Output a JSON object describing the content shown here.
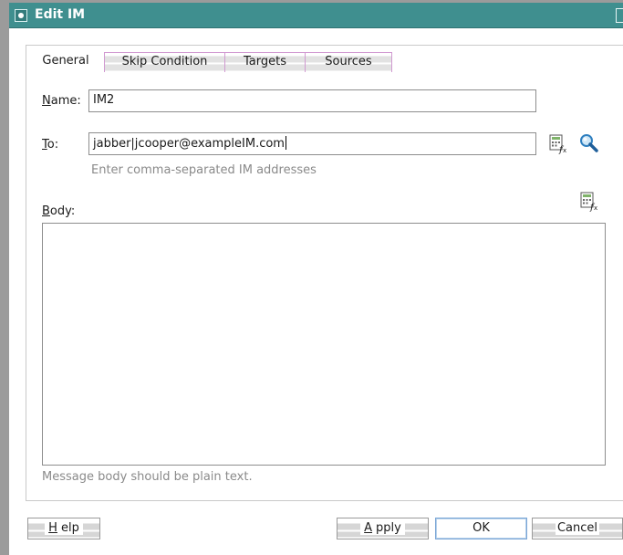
{
  "window": {
    "title": "Edit IM"
  },
  "tabs": [
    "General",
    "Skip Condition",
    "Targets",
    "Sources"
  ],
  "active_tab": "General",
  "form": {
    "name_label_mn": "N",
    "name_label_rest": "ame:",
    "name_value": "IM2",
    "to_label_mn": "T",
    "to_label_rest": "o:",
    "to_value": "jabber|jcooper@exampleIM.com",
    "to_hint": "Enter comma-separated IM addresses",
    "body_label_mn": "B",
    "body_label_rest": "ody:",
    "body_value": "",
    "body_hint": "Message body should be plain text."
  },
  "icons": {
    "expression_builder": "expression-builder-icon",
    "search": "search-icon"
  },
  "buttons": {
    "help_mn": "H",
    "help_rest": "elp",
    "apply_mn": "A",
    "apply_rest": "pply",
    "ok": "OK",
    "cancel": "Cancel"
  },
  "colors": {
    "titlebar": "#3f8f8f",
    "tab_border": "#d19ad1",
    "default_button_border": "#7aa6d6"
  }
}
